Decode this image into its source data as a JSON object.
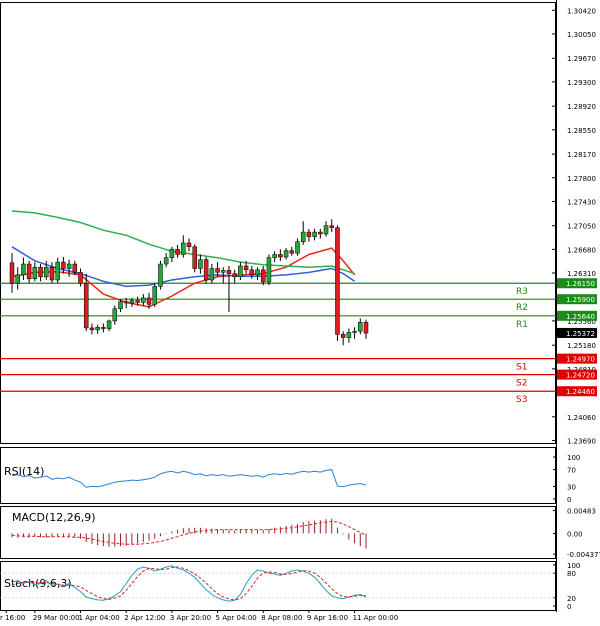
{
  "chart_data": {
    "type": "candlestick",
    "main": {
      "y_ticks": [
        "1.30420",
        "1.30050",
        "1.29670",
        "1.29300",
        "1.28920",
        "1.28550",
        "1.28170",
        "1.27800",
        "1.27430",
        "1.27050",
        "1.26680",
        "1.26310",
        "1.25560",
        "1.25180",
        "1.24810",
        "1.24060",
        "1.23690"
      ],
      "ylim": [
        1.2365,
        1.3055
      ],
      "candles": [
        {
          "o": 1.2647,
          "h": 1.2662,
          "l": 1.26,
          "c": 1.2615
        },
        {
          "o": 1.2615,
          "h": 1.264,
          "l": 1.2605,
          "c": 1.2628
        },
        {
          "o": 1.2628,
          "h": 1.2655,
          "l": 1.262,
          "c": 1.2645
        },
        {
          "o": 1.2645,
          "h": 1.265,
          "l": 1.2615,
          "c": 1.2622
        },
        {
          "o": 1.2622,
          "h": 1.2648,
          "l": 1.2618,
          "c": 1.264
        },
        {
          "o": 1.264,
          "h": 1.2645,
          "l": 1.2618,
          "c": 1.2625
        },
        {
          "o": 1.2625,
          "h": 1.265,
          "l": 1.262,
          "c": 1.264
        },
        {
          "o": 1.264,
          "h": 1.2648,
          "l": 1.2615,
          "c": 1.262
        },
        {
          "o": 1.262,
          "h": 1.2655,
          "l": 1.2615,
          "c": 1.2648
        },
        {
          "o": 1.2648,
          "h": 1.2656,
          "l": 1.263,
          "c": 1.2638
        },
        {
          "o": 1.2638,
          "h": 1.2652,
          "l": 1.2625,
          "c": 1.2645
        },
        {
          "o": 1.2645,
          "h": 1.265,
          "l": 1.2628,
          "c": 1.2632
        },
        {
          "o": 1.2632,
          "h": 1.2638,
          "l": 1.261,
          "c": 1.2615
        },
        {
          "o": 1.2615,
          "h": 1.263,
          "l": 1.254,
          "c": 1.2545
        },
        {
          "o": 1.2545,
          "h": 1.2552,
          "l": 1.2535,
          "c": 1.2542
        },
        {
          "o": 1.2542,
          "h": 1.255,
          "l": 1.2536,
          "c": 1.2546
        },
        {
          "o": 1.2546,
          "h": 1.2552,
          "l": 1.2538,
          "c": 1.2544
        },
        {
          "o": 1.2544,
          "h": 1.2558,
          "l": 1.254,
          "c": 1.2556
        },
        {
          "o": 1.2556,
          "h": 1.258,
          "l": 1.255,
          "c": 1.2575
        },
        {
          "o": 1.2575,
          "h": 1.259,
          "l": 1.257,
          "c": 1.2586
        },
        {
          "o": 1.2586,
          "h": 1.2592,
          "l": 1.2576,
          "c": 1.2584
        },
        {
          "o": 1.2584,
          "h": 1.2592,
          "l": 1.2578,
          "c": 1.2588
        },
        {
          "o": 1.2588,
          "h": 1.2594,
          "l": 1.258,
          "c": 1.2585
        },
        {
          "o": 1.2585,
          "h": 1.2598,
          "l": 1.258,
          "c": 1.2592
        },
        {
          "o": 1.2592,
          "h": 1.26,
          "l": 1.2575,
          "c": 1.2582
        },
        {
          "o": 1.2582,
          "h": 1.2615,
          "l": 1.2578,
          "c": 1.261
        },
        {
          "o": 1.261,
          "h": 1.265,
          "l": 1.2605,
          "c": 1.2645
        },
        {
          "o": 1.2645,
          "h": 1.2662,
          "l": 1.264,
          "c": 1.2655
        },
        {
          "o": 1.2655,
          "h": 1.2672,
          "l": 1.2648,
          "c": 1.2668
        },
        {
          "o": 1.2668,
          "h": 1.2675,
          "l": 1.2655,
          "c": 1.266
        },
        {
          "o": 1.266,
          "h": 1.269,
          "l": 1.2655,
          "c": 1.2678
        },
        {
          "o": 1.2678,
          "h": 1.2685,
          "l": 1.2665,
          "c": 1.2672
        },
        {
          "o": 1.2672,
          "h": 1.2676,
          "l": 1.2632,
          "c": 1.2638
        },
        {
          "o": 1.2638,
          "h": 1.266,
          "l": 1.263,
          "c": 1.2652
        },
        {
          "o": 1.2652,
          "h": 1.2656,
          "l": 1.2615,
          "c": 1.262
        },
        {
          "o": 1.262,
          "h": 1.2645,
          "l": 1.2615,
          "c": 1.2638
        },
        {
          "o": 1.2638,
          "h": 1.2648,
          "l": 1.2625,
          "c": 1.2632
        },
        {
          "o": 1.2632,
          "h": 1.264,
          "l": 1.2615,
          "c": 1.2635
        },
        {
          "o": 1.2635,
          "h": 1.2642,
          "l": 1.257,
          "c": 1.263
        },
        {
          "o": 1.263,
          "h": 1.2636,
          "l": 1.2615,
          "c": 1.2625
        },
        {
          "o": 1.2625,
          "h": 1.2648,
          "l": 1.262,
          "c": 1.2642
        },
        {
          "o": 1.2642,
          "h": 1.265,
          "l": 1.263,
          "c": 1.2636
        },
        {
          "o": 1.2636,
          "h": 1.2642,
          "l": 1.2622,
          "c": 1.2628
        },
        {
          "o": 1.2628,
          "h": 1.264,
          "l": 1.262,
          "c": 1.2636
        },
        {
          "o": 1.2636,
          "h": 1.2642,
          "l": 1.2612,
          "c": 1.2617
        },
        {
          "o": 1.2617,
          "h": 1.266,
          "l": 1.2612,
          "c": 1.2655
        },
        {
          "o": 1.2655,
          "h": 1.2665,
          "l": 1.2648,
          "c": 1.266
        },
        {
          "o": 1.266,
          "h": 1.2668,
          "l": 1.265,
          "c": 1.2656
        },
        {
          "o": 1.2656,
          "h": 1.267,
          "l": 1.2652,
          "c": 1.2666
        },
        {
          "o": 1.2666,
          "h": 1.2672,
          "l": 1.2658,
          "c": 1.2662
        },
        {
          "o": 1.2662,
          "h": 1.2685,
          "l": 1.2658,
          "c": 1.268
        },
        {
          "o": 1.268,
          "h": 1.2712,
          "l": 1.2675,
          "c": 1.2695
        },
        {
          "o": 1.2695,
          "h": 1.27,
          "l": 1.268,
          "c": 1.2688
        },
        {
          "o": 1.2688,
          "h": 1.27,
          "l": 1.2682,
          "c": 1.2695
        },
        {
          "o": 1.2695,
          "h": 1.27,
          "l": 1.2685,
          "c": 1.2692
        },
        {
          "o": 1.2692,
          "h": 1.2712,
          "l": 1.2688,
          "c": 1.2705
        },
        {
          "o": 1.2705,
          "h": 1.2715,
          "l": 1.2695,
          "c": 1.2702
        },
        {
          "o": 1.2702,
          "h": 1.2706,
          "l": 1.2525,
          "c": 1.2535
        },
        {
          "o": 1.2535,
          "h": 1.254,
          "l": 1.2518,
          "c": 1.253
        },
        {
          "o": 1.253,
          "h": 1.2544,
          "l": 1.2522,
          "c": 1.2538
        },
        {
          "o": 1.2538,
          "h": 1.2546,
          "l": 1.2528,
          "c": 1.254
        },
        {
          "o": 1.254,
          "h": 1.256,
          "l": 1.2535,
          "c": 1.2554
        },
        {
          "o": 1.2554,
          "h": 1.2558,
          "l": 1.2528,
          "c": 1.2537
        }
      ],
      "moving_averages": [
        {
          "color": "#e8281e",
          "points": [
            [
              0,
              1.2625
            ],
            [
              4,
              1.2632
            ],
            [
              8,
              1.2633
            ],
            [
              12,
              1.2628
            ],
            [
              16,
              1.2598
            ],
            [
              20,
              1.2585
            ],
            [
              24,
              1.2578
            ],
            [
              28,
              1.2595
            ],
            [
              32,
              1.2615
            ],
            [
              36,
              1.2625
            ],
            [
              40,
              1.2628
            ],
            [
              44,
              1.263
            ],
            [
              48,
              1.264
            ],
            [
              52,
              1.266
            ],
            [
              56,
              1.267
            ],
            [
              58,
              1.265
            ],
            [
              60,
              1.2628
            ]
          ]
        },
        {
          "color": "#3060d8",
          "points": [
            [
              0,
              1.2672
            ],
            [
              4,
              1.265
            ],
            [
              8,
              1.2638
            ],
            [
              12,
              1.263
            ],
            [
              16,
              1.2618
            ],
            [
              20,
              1.261
            ],
            [
              24,
              1.2612
            ],
            [
              28,
              1.262
            ],
            [
              32,
              1.2625
            ],
            [
              36,
              1.2628
            ],
            [
              40,
              1.2626
            ],
            [
              44,
              1.2626
            ],
            [
              48,
              1.2628
            ],
            [
              52,
              1.2632
            ],
            [
              56,
              1.2638
            ],
            [
              58,
              1.263
            ],
            [
              60,
              1.2618
            ]
          ]
        },
        {
          "color": "#2eaf4e",
          "points": [
            [
              0,
              1.2728
            ],
            [
              4,
              1.2725
            ],
            [
              8,
              1.2718
            ],
            [
              12,
              1.271
            ],
            [
              16,
              1.2698
            ],
            [
              20,
              1.269
            ],
            [
              24,
              1.2676
            ],
            [
              28,
              1.2665
            ],
            [
              32,
              1.266
            ],
            [
              36,
              1.2655
            ],
            [
              40,
              1.2648
            ],
            [
              44,
              1.2644
            ],
            [
              48,
              1.2642
            ],
            [
              52,
              1.264
            ],
            [
              56,
              1.2642
            ],
            [
              58,
              1.2636
            ],
            [
              60,
              1.263
            ]
          ]
        }
      ],
      "levels": [
        {
          "label": "R3",
          "value": 1.2615,
          "value_label": "1.26150",
          "color": "#1a8c1a"
        },
        {
          "label": "R2",
          "value": 1.259,
          "value_label": "1.25900",
          "color": "#1a8c1a"
        },
        {
          "label": "R1",
          "value": 1.2564,
          "value_label": "1.25640",
          "color": "#1a8c1a"
        },
        {
          "label": "S1",
          "value": 1.2497,
          "value_label": "1.24970",
          "color": "#e00000"
        },
        {
          "label": "S2",
          "value": 1.2472,
          "value_label": "1.24720",
          "color": "#e00000"
        },
        {
          "label": "S3",
          "value": 1.2446,
          "value_label": "1.24460",
          "color": "#e00000"
        }
      ],
      "current_price": "1.25372"
    },
    "rsi": {
      "title": "RSI(14)",
      "y_ticks": [
        "100",
        "70",
        "30",
        "0"
      ],
      "ylim": [
        0,
        100
      ],
      "color": "#2d7fd8",
      "values": [
        55,
        58,
        53,
        56,
        50,
        52,
        55,
        47,
        50,
        48,
        52,
        45,
        40,
        28,
        30,
        29,
        32,
        36,
        40,
        42,
        43,
        45,
        44,
        46,
        48,
        52,
        60,
        64,
        66,
        62,
        66,
        63,
        58,
        60,
        55,
        58,
        56,
        58,
        54,
        56,
        58,
        56,
        54,
        56,
        52,
        58,
        60,
        58,
        61,
        59,
        63,
        66,
        64,
        66,
        64,
        68,
        70,
        31,
        29,
        33,
        35,
        37,
        33
      ]
    },
    "macd": {
      "title": "MACD(12,26,9)",
      "y_ticks": [
        "0.00483",
        "0.00",
        "-0.004377"
      ],
      "ylim": [
        -0.0052,
        0.0058
      ],
      "hist_color": "#9b1c2c",
      "signal_color": "#e02020",
      "hist": [
        -0.0008,
        -0.0009,
        -0.0008,
        -0.0009,
        -0.0007,
        -0.0008,
        -0.0009,
        -0.0008,
        -0.0006,
        -0.0007,
        -0.0008,
        -0.0009,
        -0.0011,
        -0.0018,
        -0.0022,
        -0.0025,
        -0.0027,
        -0.0028,
        -0.0028,
        -0.0027,
        -0.0026,
        -0.0024,
        -0.0021,
        -0.0018,
        -0.0015,
        -0.0011,
        -0.0006,
        -0.0001,
        0.0004,
        0.0008,
        0.0011,
        0.0012,
        0.0012,
        0.0012,
        0.0011,
        0.001,
        0.0009,
        0.0008,
        0.0007,
        0.0006,
        0.0007,
        0.0008,
        0.0008,
        0.0007,
        0.0007,
        0.0009,
        0.0012,
        0.0014,
        0.0016,
        0.0018,
        0.002,
        0.0024,
        0.0026,
        0.0027,
        0.0028,
        0.003,
        0.0031,
        0.0012,
        -0.0002,
        -0.0013,
        -0.0021,
        -0.0027,
        -0.0032
      ],
      "signal": [
        -0.0004,
        -0.0005,
        -0.0006,
        -0.0006,
        -0.0006,
        -0.0007,
        -0.0007,
        -0.0007,
        -0.0007,
        -0.0007,
        -0.0007,
        -0.0008,
        -0.0008,
        -0.001,
        -0.0012,
        -0.0015,
        -0.0017,
        -0.0019,
        -0.0021,
        -0.0022,
        -0.0023,
        -0.0023,
        -0.0023,
        -0.0022,
        -0.0021,
        -0.0019,
        -0.0017,
        -0.0014,
        -0.001,
        -0.0007,
        -0.0003,
        0.0,
        0.0003,
        0.0005,
        0.0006,
        0.0007,
        0.0008,
        0.0008,
        0.0008,
        0.0008,
        0.0008,
        0.0008,
        0.0008,
        0.0008,
        0.0008,
        0.0008,
        0.0009,
        0.001,
        0.0011,
        0.0012,
        0.0014,
        0.0016,
        0.0018,
        0.002,
        0.0022,
        0.0024,
        0.0026,
        0.0024,
        0.002,
        0.0014,
        0.0008,
        0.0002,
        -0.0004
      ]
    },
    "stoch": {
      "title": "Stoch(9,6,3)",
      "y_ticks": [
        "100",
        "80",
        "20",
        "0"
      ],
      "ylim": [
        0,
        100
      ],
      "main_color": "#2aa0c8",
      "signal_color": "#e02020",
      "main": [
        58,
        62,
        55,
        60,
        52,
        55,
        62,
        50,
        54,
        48,
        55,
        45,
        35,
        22,
        18,
        15,
        14,
        18,
        25,
        35,
        55,
        75,
        90,
        95,
        92,
        85,
        90,
        95,
        98,
        92,
        88,
        80,
        70,
        55,
        40,
        28,
        20,
        15,
        12,
        14,
        28,
        55,
        75,
        88,
        85,
        80,
        78,
        75,
        80,
        85,
        88,
        85,
        80,
        70,
        55,
        38,
        25,
        20,
        18,
        22,
        26,
        28,
        22
      ],
      "signal": [
        52,
        55,
        58,
        58,
        57,
        56,
        57,
        55,
        53,
        51,
        51,
        50,
        46,
        38,
        30,
        23,
        18,
        16,
        19,
        25,
        38,
        55,
        72,
        85,
        92,
        91,
        89,
        90,
        94,
        95,
        92,
        86,
        78,
        68,
        56,
        42,
        30,
        22,
        17,
        15,
        18,
        30,
        48,
        68,
        80,
        83,
        82,
        78,
        77,
        79,
        83,
        86,
        85,
        80,
        70,
        56,
        42,
        30,
        23,
        22,
        24,
        26,
        25
      ]
    },
    "x_labels": [
      {
        "i": -1,
        "text": "r 16:00"
      },
      {
        "i": 4,
        "text": "29 Mar 00:00"
      },
      {
        "i": 12,
        "text": "1 Apr 04:00"
      },
      {
        "i": 20,
        "text": "2 Apr 12:00"
      },
      {
        "i": 28,
        "text": "3 Apr 20:00"
      },
      {
        "i": 36,
        "text": "5 Apr 04:00"
      },
      {
        "i": 44,
        "text": "8 Apr 08:00"
      },
      {
        "i": 52,
        "text": "9 Apr 16:00"
      },
      {
        "i": 60,
        "text": "11 Apr 00:00"
      }
    ]
  }
}
